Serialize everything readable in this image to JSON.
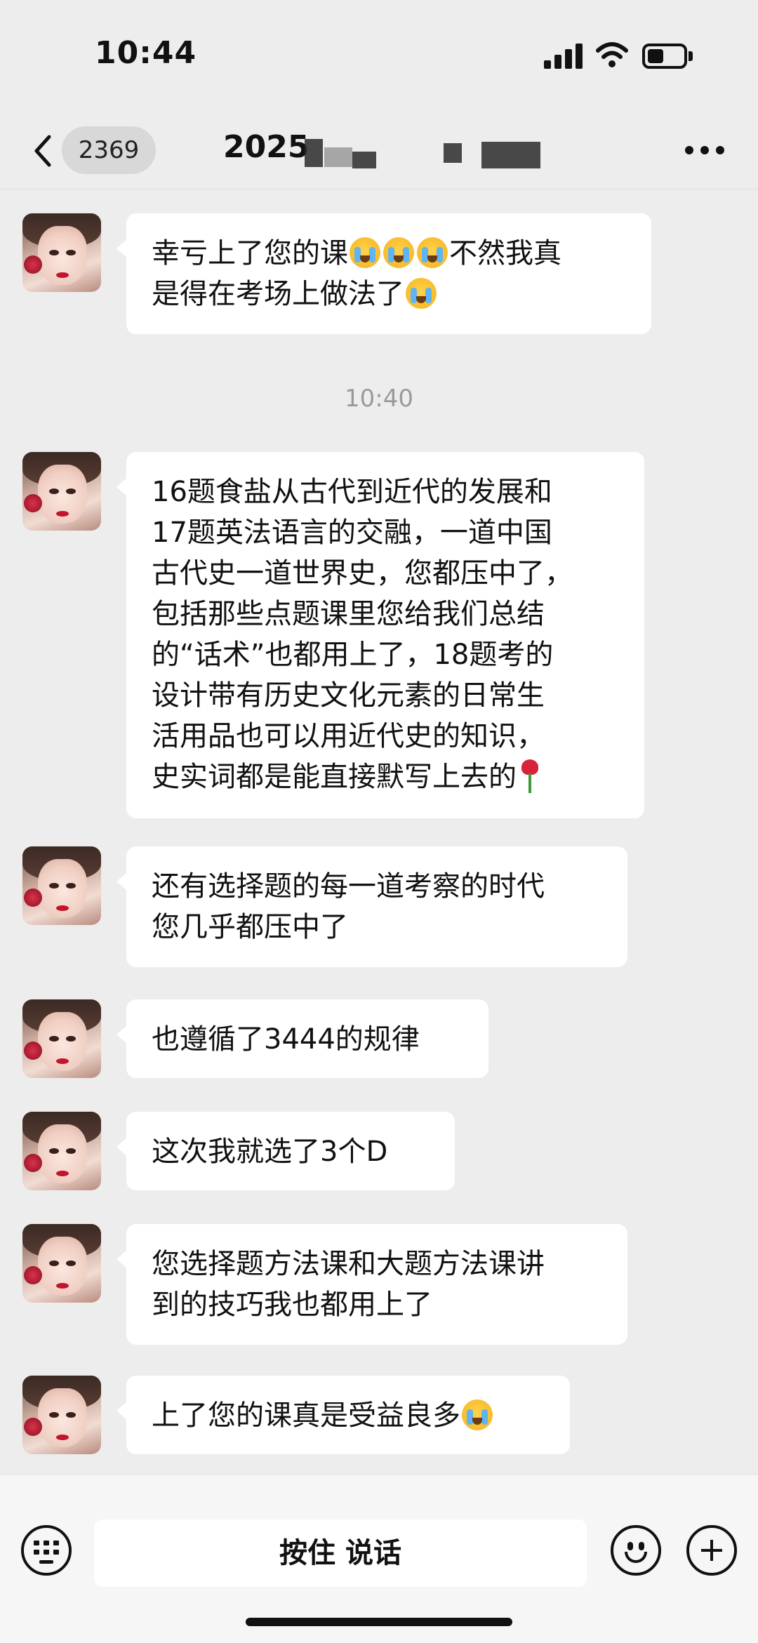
{
  "status_bar": {
    "time": "10:44",
    "icons": [
      "signal-icon",
      "wifi-icon",
      "battery-icon"
    ]
  },
  "nav": {
    "back_icon": "chevron-left-icon",
    "unread_count": "2369",
    "title_visible": "2025",
    "title_redacted": true,
    "more_icon": "more-icon"
  },
  "messages": [
    {
      "sender": "other",
      "parts": [
        {
          "text": "幸亏上了您的课"
        },
        {
          "emoji": "loudly-crying-face-icon"
        },
        {
          "emoji": "loudly-crying-face-icon"
        },
        {
          "emoji": "loudly-crying-face-icon"
        },
        {
          "text": "不然我真"
        },
        {
          "break": true
        },
        {
          "text": "是得在考场上做法了"
        },
        {
          "emoji": "loudly-crying-face-icon"
        }
      ]
    },
    {
      "timestamp": "10:40"
    },
    {
      "sender": "other",
      "lines": [
        "16题食盐从古代到近代的发展和",
        "17题英法语言的交融，一道中国",
        "古代史一道世界史，您都压中了，",
        "包括那些点题课里您给我们总结",
        "的“话术”也都用上了，18题考的",
        "设计带有历史文化元素的日常生",
        "活用品也可以用近代史的知识，",
        "史实词都是能直接默写上去的"
      ],
      "trailing_emoji": "rose-icon"
    },
    {
      "sender": "other",
      "lines": [
        "还有选择题的每一道考察的时代",
        "您几乎都压中了"
      ]
    },
    {
      "sender": "other",
      "lines": [
        "也遵循了3444的规律"
      ]
    },
    {
      "sender": "other",
      "lines": [
        "这次我就选了3个D"
      ]
    },
    {
      "sender": "other",
      "lines": [
        "您选择题方法课和大题方法课讲",
        "到的技巧我也都用上了"
      ]
    },
    {
      "sender": "other",
      "lines": [
        "上了您的课真是受益良多"
      ],
      "trailing_emoji": "loudly-crying-face-icon"
    }
  ],
  "input_bar": {
    "keyboard_icon": "keyboard-icon",
    "hold_to_talk_label": "按住 说话",
    "emoji_icon": "smiley-icon",
    "plus_icon": "plus-icon"
  },
  "colors": {
    "background": "#ededed",
    "bubble": "#ffffff",
    "text": "#111111",
    "timestamp": "#9a9a9a"
  }
}
